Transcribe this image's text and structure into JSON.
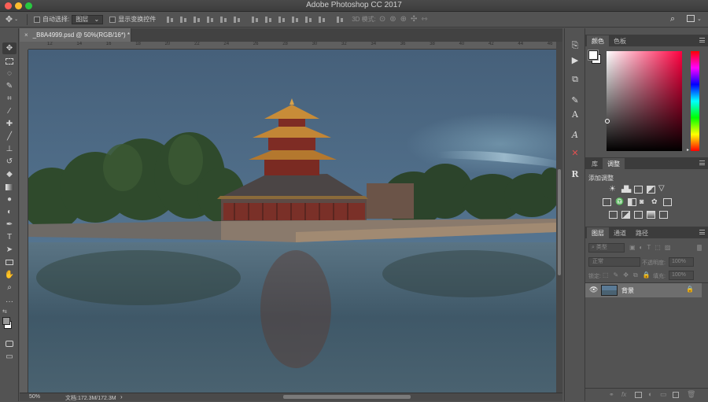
{
  "window": {
    "title": "Adobe Photoshop CC 2017"
  },
  "traffic_colors": {
    "close": "#fc5f57",
    "minimize": "#fdbc2e",
    "zoom": "#28c840"
  },
  "options": {
    "auto_select_label": "自动选择:",
    "auto_select_value": "图层",
    "show_transform_label": "显示变换控件",
    "mode_3d_label": "3D 模式:"
  },
  "document": {
    "tab_label": "_B8A4999.psd @ 50%(RGB/16*) *",
    "close_glyph": "×",
    "zoom": "50%",
    "doc_size": "文档:172.3M/172.3M",
    "ruler_ticks": [
      "12",
      "14",
      "16",
      "18",
      "20",
      "22",
      "24",
      "26",
      "28",
      "30",
      "32",
      "34",
      "36",
      "38",
      "40",
      "42",
      "44",
      "46"
    ]
  },
  "color_panel": {
    "tabs": [
      "颜色",
      "色板"
    ],
    "foreground": "#ffffff",
    "background": "#ffffff",
    "hue": "#ff0040"
  },
  "adjust_panel": {
    "tabs": [
      "库",
      "调整"
    ],
    "add_label": "添加调整"
  },
  "layers_panel": {
    "tabs": [
      "图层",
      "通道",
      "路径"
    ],
    "filter_placeholder": "类型",
    "blend_mode": "正常",
    "opacity_label": "不透明度:",
    "opacity_value": "100%",
    "lock_label": "锁定:",
    "fill_label": "填充:",
    "fill_value": "100%",
    "layers": [
      {
        "name": "背景",
        "visible": true,
        "locked": true
      }
    ]
  }
}
